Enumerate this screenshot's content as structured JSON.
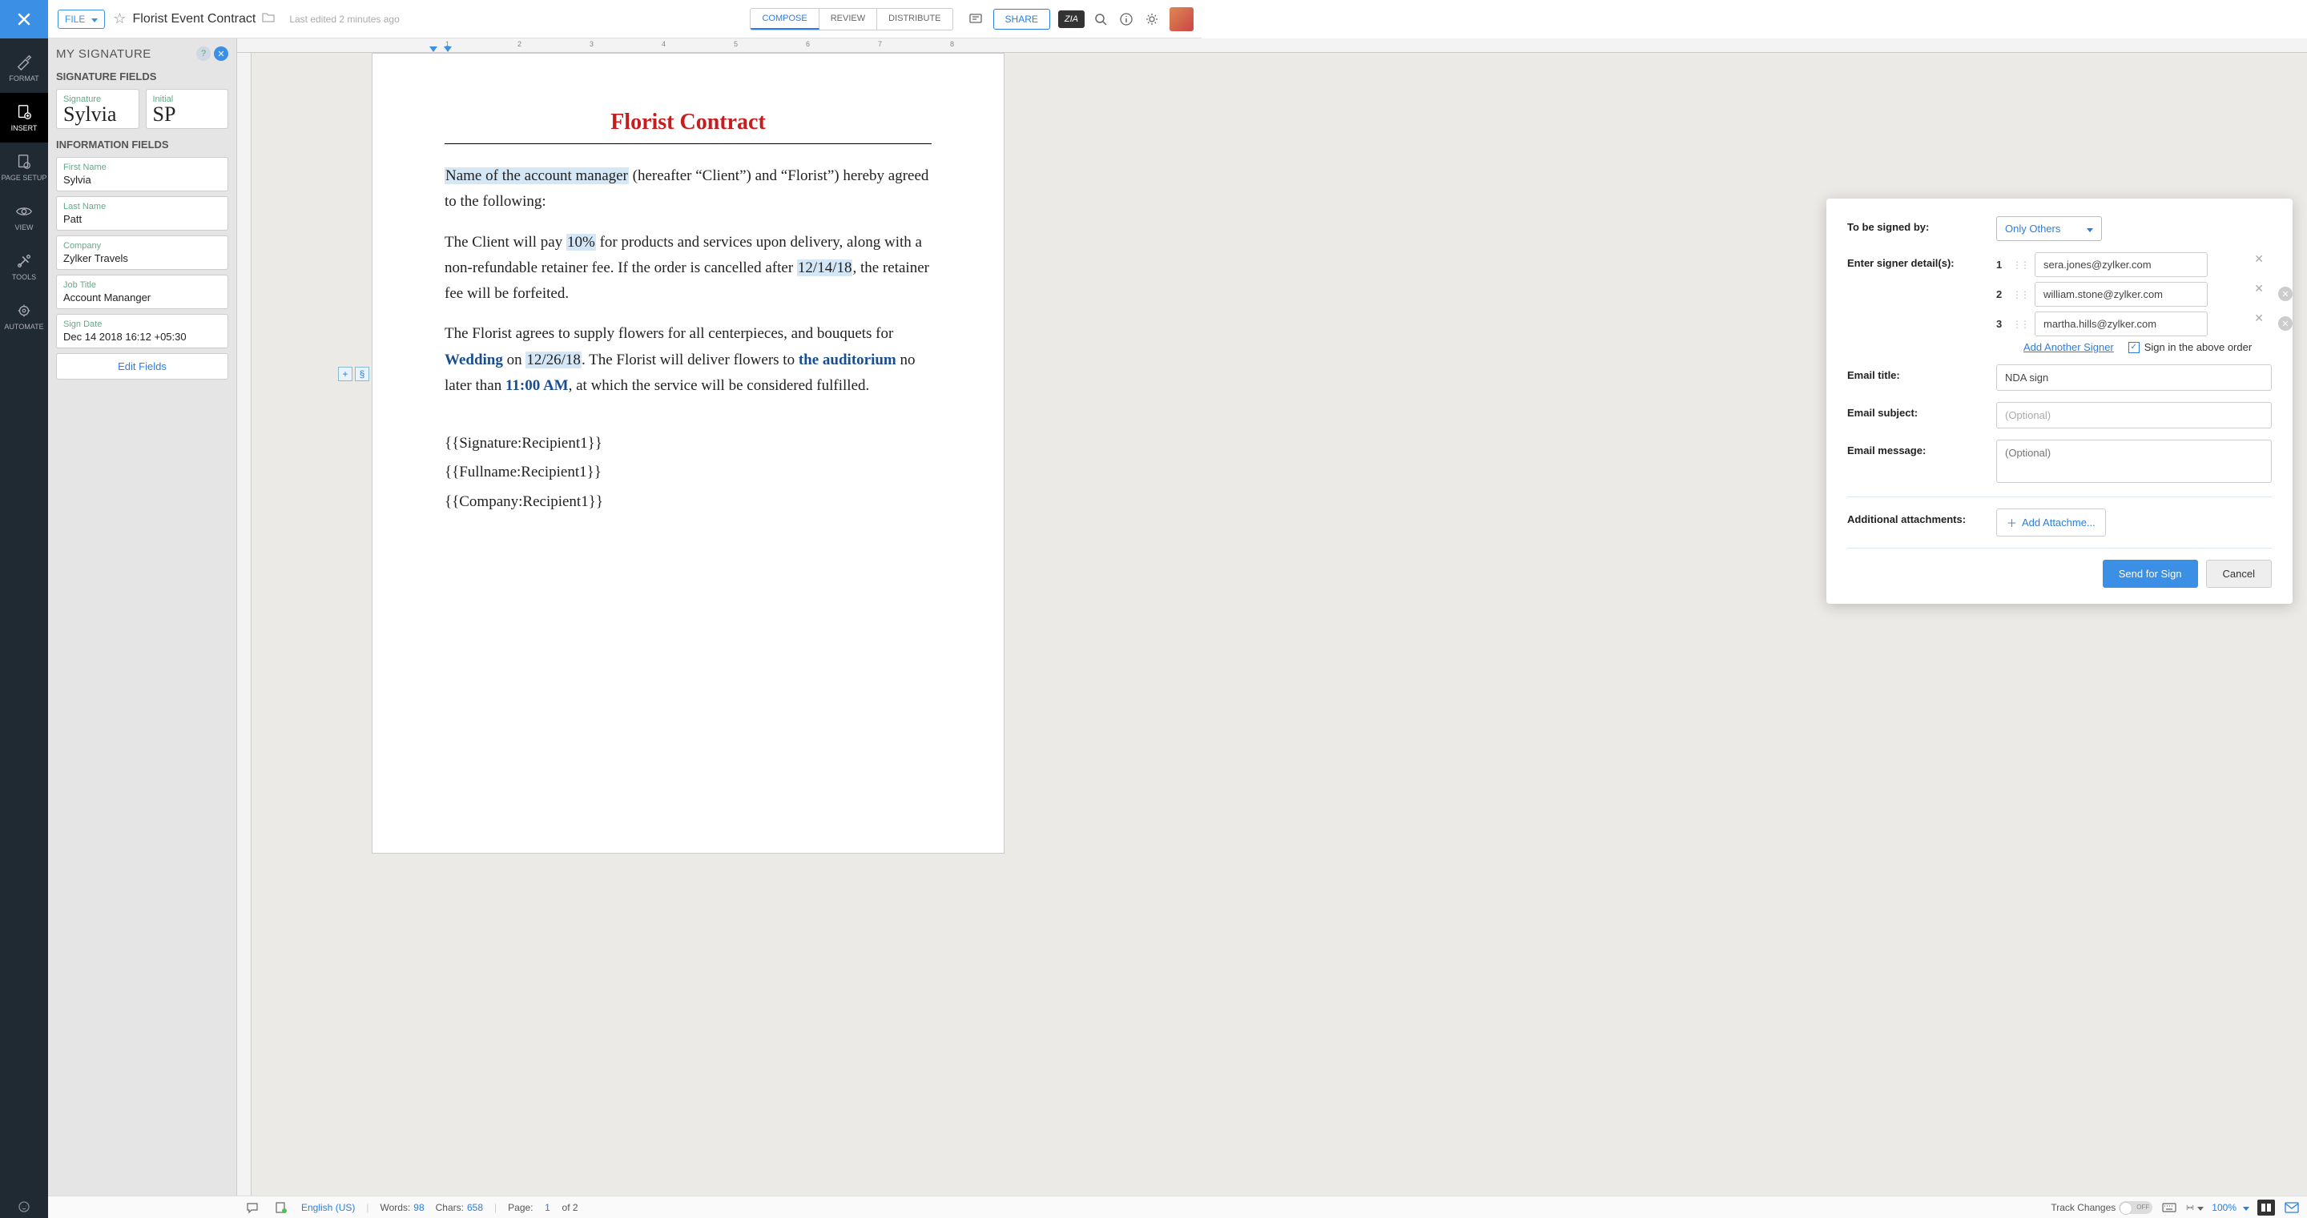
{
  "header": {
    "file_label": "FILE",
    "doc_title": "Florist Event Contract",
    "last_edited": "Last edited 2 minutes ago",
    "tabs": {
      "compose": "COMPOSE",
      "review": "REVIEW",
      "distribute": "DISTRIBUTE"
    },
    "share": "SHARE",
    "zia": "ZIA"
  },
  "rail": {
    "format": "FORMAT",
    "insert": "INSERT",
    "page_setup": "PAGE SETUP",
    "view": "VIEW",
    "tools": "TOOLS",
    "automate": "AUTOMATE"
  },
  "sig_panel": {
    "title": "MY SIGNATURE",
    "section_sig": "SIGNATURE FIELDS",
    "signature_label": "Signature",
    "signature_script": "Sylvia",
    "initial_label": "Initial",
    "initial_script": "SP",
    "section_info": "INFORMATION FIELDS",
    "fields": [
      {
        "label": "First Name",
        "value": "Sylvia"
      },
      {
        "label": "Last Name",
        "value": "Patt"
      },
      {
        "label": "Company",
        "value": "Zylker Travels"
      },
      {
        "label": "Job Title",
        "value": "Account Mananger"
      },
      {
        "label": "Sign Date",
        "value": "Dec 14 2018 16:12 +05:30"
      }
    ],
    "edit_btn": "Edit Fields"
  },
  "document": {
    "title": "Florist Contract",
    "p1_hl": "Name of the account manager",
    "p1_rest": " (hereafter “Client”) and “Florist”) hereby agreed to the following:",
    "p2_a": "The Client will pay ",
    "p2_pct": "10%",
    "p2_b": " for products and services upon delivery, along with a non-refundable retainer fee. If the order is cancelled after ",
    "p2_date": "12/14/18",
    "p2_c": ", the retainer fee will be forfeited.",
    "p3_a": "The Florist agrees to supply flowers for all centerpieces, and bouquets for ",
    "p3_event": "Wedding",
    "p3_b": " on ",
    "p3_date": "12/26/18",
    "p3_c": ". The Florist will deliver flowers to ",
    "p3_venue": "the auditorium",
    "p3_d": " no later than ",
    "p3_time": "11:00 AM",
    "p3_e": ", at which the service will be considered fulfilled.",
    "tags": [
      "{{Signature:Recipient1}}",
      "{{Fullname:Recipient1}}",
      "{{Company:Recipient1}}"
    ]
  },
  "sign_dialog": {
    "to_be_signed_label": "To be signed by:",
    "to_be_signed_value": "Only Others",
    "enter_signer_label": "Enter signer detail(s):",
    "signers": [
      {
        "n": "1",
        "email": "sera.jones@zylker.com"
      },
      {
        "n": "2",
        "email": "william.stone@zylker.com"
      },
      {
        "n": "3",
        "email": "martha.hills@zylker.com"
      }
    ],
    "add_another": "Add Another Signer",
    "order_label": "Sign in the above order",
    "email_title_label": "Email title:",
    "email_title_value": "NDA sign",
    "email_subject_label": "Email subject:",
    "email_subject_placeholder": "(Optional)",
    "email_message_label": "Email message:",
    "email_message_placeholder": "(Optional)",
    "attachments_label": "Additional attachments:",
    "add_attach_btn": "Add Attachme...",
    "send_btn": "Send for Sign",
    "cancel_btn": "Cancel"
  },
  "statusbar": {
    "language": "English (US)",
    "words_label": "Words:",
    "words": "98",
    "chars_label": "Chars:",
    "chars": "658",
    "page_label": "Page:",
    "page_cur": "1",
    "page_of": "of 2",
    "track_label": "Track Changes",
    "track_state": "OFF",
    "zoom": "100%"
  }
}
